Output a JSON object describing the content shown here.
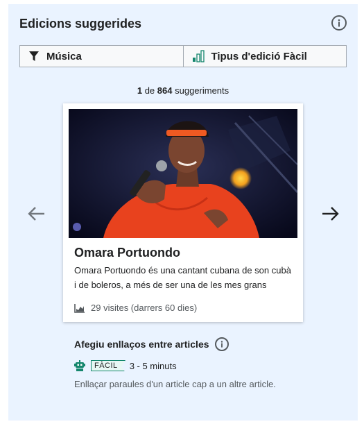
{
  "header": {
    "title": "Edicions suggerides"
  },
  "filters": {
    "topic_label": "Música",
    "difficulty_label": "Tipus d'edició Fàcil"
  },
  "counter": {
    "current": "1",
    "separator": "de",
    "total": "864",
    "suffix": "suggeriments"
  },
  "card": {
    "title": "Omara Portuondo",
    "extract": "Omara Portuondo és una cantant cubana de son cubà i de boleros, a més de ser una de les mes grans",
    "views": "29 visites (darrers 60 dies)"
  },
  "task": {
    "title": "Afegiu enllaços entre articles",
    "difficulty_badge": "FÀCIL",
    "time": "3 - 5 minuts",
    "description": "Enllaçar paraules d'un article cap a un altre article."
  },
  "colors": {
    "module_background": "#eaf3ff",
    "easy_green": "#14866d",
    "text": "#202122",
    "muted": "#54595d"
  },
  "icons": {
    "info": "info-icon",
    "filter": "funnel-icon",
    "difficulty": "bar-chart-icon",
    "prev": "arrow-left-icon",
    "next": "arrow-right-icon",
    "views": "chart-icon",
    "robot": "robot-icon"
  }
}
